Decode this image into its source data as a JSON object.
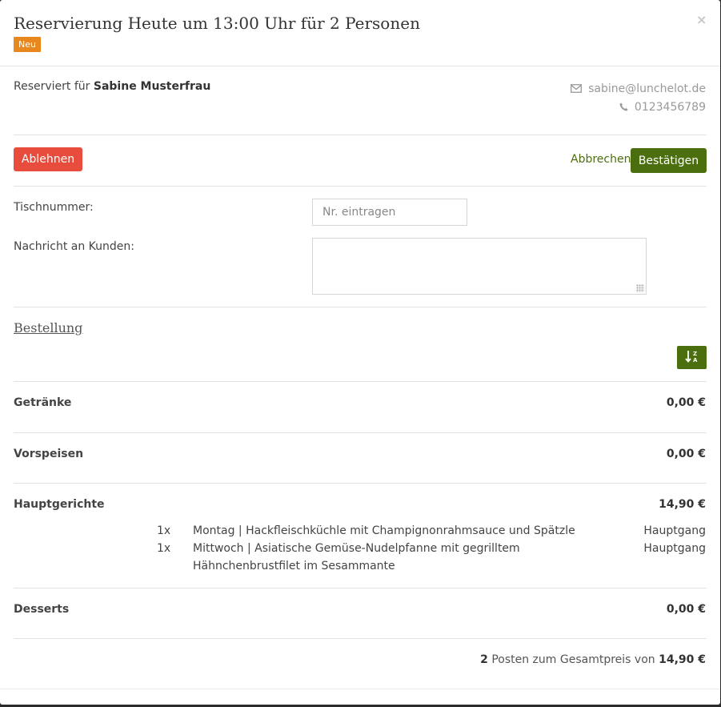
{
  "header": {
    "title": "Reservierung Heute um 13:00 Uhr für 2 Personen",
    "badge": "Neu",
    "close": "×"
  },
  "reservation": {
    "prefix": "Reserviert für ",
    "name": "Sabine Musterfrau",
    "email": "sabine@lunchelot.de",
    "phone": "0123456789"
  },
  "actions": {
    "reject": "Ablehnen",
    "cancel": "Abbrechen",
    "confirm": "Bestätigen"
  },
  "form": {
    "table_label": "Tischnummer:",
    "table_placeholder": "Nr. eintragen",
    "message_label": "Nachricht an Kunden:"
  },
  "order": {
    "title": "Bestellung",
    "sort_icon": "sort-alpha-icon",
    "categories": [
      {
        "name": "Getränke",
        "amount": "0,00 €"
      },
      {
        "name": "Vorspeisen",
        "amount": "0,00 €"
      },
      {
        "name": "Hauptgerichte",
        "amount": "14,90 €"
      },
      {
        "name": "Desserts",
        "amount": "0,00 €"
      }
    ],
    "items": [
      {
        "qty": "1x",
        "name": "Montag | Hackfleischküchle mit Champignonrahmsauce und Spätzle",
        "type": "Hauptgang"
      },
      {
        "qty": "1x",
        "name": "Mittwoch | Asiatische Gemüse-Nudelpfanne mit gegrilltem Hähnchenbrustfilet im Sesammante",
        "type": "Hauptgang"
      }
    ],
    "summary": {
      "count": "2",
      "text": " Posten zum Gesamtpreis von ",
      "total": "14,90 €"
    }
  },
  "colors": {
    "accent_green": "#4b6f0f",
    "danger": "#e74c3c",
    "badge": "#e8871e"
  }
}
